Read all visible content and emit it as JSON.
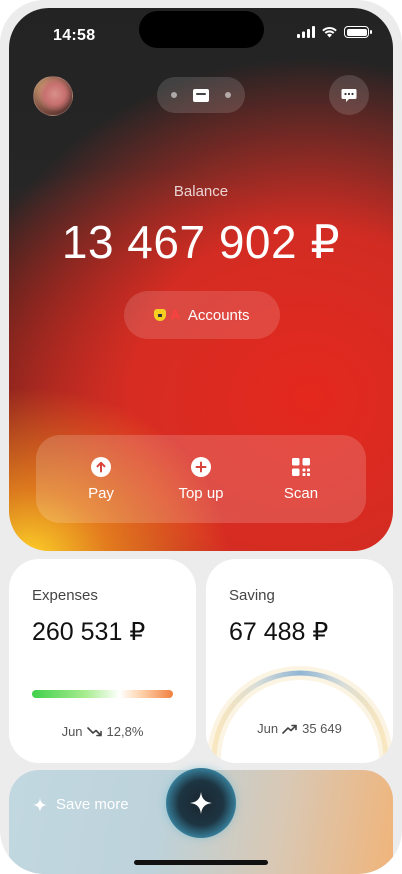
{
  "status_bar": {
    "time": "14:58"
  },
  "header": {
    "avatar": "user-avatar",
    "switcher_icon": "wallet-icon",
    "chat_icon": "chat-bubble-icon"
  },
  "balance": {
    "label": "Balance",
    "amount": "13 467 902 ₽"
  },
  "accounts": {
    "label": "Accounts"
  },
  "actions": [
    {
      "label": "Pay",
      "icon": "arrow-up-circle-icon"
    },
    {
      "label": "Top up",
      "icon": "plus-circle-icon"
    },
    {
      "label": "Scan",
      "icon": "qr-code-icon"
    }
  ],
  "expenses": {
    "title": "Expenses",
    "amount": "260 531 ₽",
    "month": "Jun",
    "change": "12,8%",
    "trend": "down"
  },
  "saving": {
    "title": "Saving",
    "amount": "67 488 ₽",
    "month": "Jun",
    "change": "35 649",
    "trend": "up"
  },
  "save_more": {
    "label": "Save more"
  },
  "colors": {
    "accent_red": "#e0281e",
    "accent_yellow": "#f5d020",
    "positive_green": "#3fd04a",
    "saving_blue": "#5aa0e8"
  }
}
